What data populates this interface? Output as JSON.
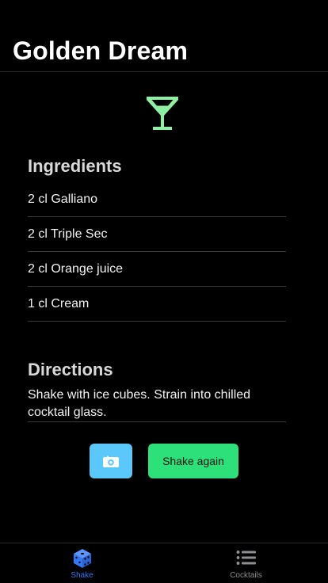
{
  "header": {
    "title": "Golden Dream"
  },
  "cocktail": {
    "icon": "cocktail-glass-icon",
    "ingredients_heading": "Ingredients",
    "ingredients": [
      "2 cl Galliano",
      "2 cl Triple Sec",
      "2 cl Orange juice",
      "1 cl Cream"
    ],
    "directions_heading": "Directions",
    "directions": "Shake with ice cubes. Strain into chilled cocktail glass."
  },
  "actions": {
    "camera_icon": "camera-icon",
    "shake_again_label": "Shake again"
  },
  "tab_bar": {
    "tabs": [
      {
        "label": "Shake",
        "icon": "dice-icon",
        "active": true
      },
      {
        "label": "Cocktails",
        "icon": "list-icon",
        "active": false
      }
    ]
  },
  "colors": {
    "glass_icon": "#8ff0a4",
    "camera_button": "#5ac8fa",
    "shake_again_button": "#2ee07a",
    "tab_active": "#3478f6",
    "tab_inactive": "#8e8e93"
  }
}
